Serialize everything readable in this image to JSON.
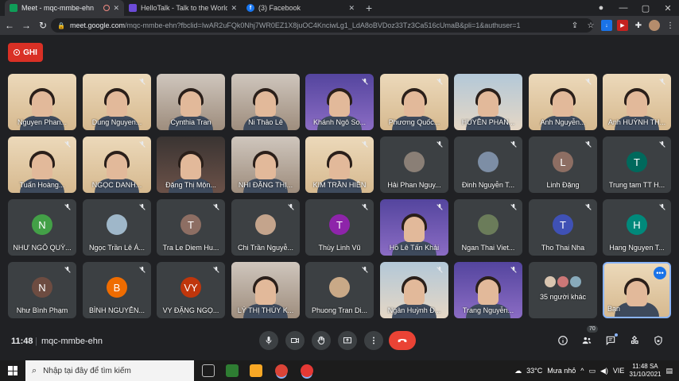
{
  "browser": {
    "tabs": [
      {
        "title": "Meet - mqc-mmbe-ehn",
        "favicon_color": "#0f9d58",
        "active": true
      },
      {
        "title": "HelloTalk - Talk to the World",
        "favicon_color": "#6c4bd8",
        "active": false
      },
      {
        "title": "(3) Facebook",
        "favicon_color": "#1877f2",
        "active": false
      }
    ],
    "new_tab_label": "+",
    "url_domain": "meet.google.com",
    "url_path": "/mqc-mmbe-ehn?fbclid=IwAR2uFQk0Nhj7WR0EZ1X8juOC4KnciwLg1_LdA8oBVDoz33Tz3Ca516cUmaB&pli=1&authuser=1"
  },
  "meet": {
    "record_label": "GHI",
    "participants": [
      {
        "name": "Nguyen Phan...",
        "type": "video",
        "style": "beige",
        "muted": false
      },
      {
        "name": "Dung Nguyen...",
        "type": "video",
        "style": "beige",
        "muted": true
      },
      {
        "name": "Cynthia Tran",
        "type": "video",
        "style": "room",
        "muted": false
      },
      {
        "name": "Ni Thảo Lê",
        "type": "video",
        "style": "room",
        "muted": false
      },
      {
        "name": "Khánh Ngô So...",
        "type": "video",
        "style": "purple",
        "muted": true
      },
      {
        "name": "Phương Quốc...",
        "type": "video",
        "style": "beige",
        "muted": true
      },
      {
        "name": "HUYỀN PHAN...",
        "type": "video",
        "style": "window",
        "muted": false
      },
      {
        "name": "Anh Nguyễn...",
        "type": "video",
        "style": "beige",
        "muted": true
      },
      {
        "name": "Anh HUỲNH TH...",
        "type": "video",
        "style": "beige",
        "muted": true
      },
      {
        "name": "Tuấn Hoàng...",
        "type": "video",
        "style": "beige",
        "muted": true
      },
      {
        "name": "NGỌC DANH...",
        "type": "video",
        "style": "beige",
        "muted": true
      },
      {
        "name": "Đặng Thị Mộn...",
        "type": "video",
        "style": "dark",
        "muted": false
      },
      {
        "name": "NHI ĐẶNG THỊ...",
        "type": "video",
        "style": "room",
        "muted": false
      },
      {
        "name": "KIM TRẦN HIỀN",
        "type": "video",
        "style": "beige",
        "muted": true
      },
      {
        "name": "Hải Phan Nguy...",
        "type": "avatar",
        "letter": "",
        "color": "#8a7f76",
        "muted": true
      },
      {
        "name": "Đinh Nguyễn T...",
        "type": "avatar",
        "letter": "",
        "color": "#7d8ea5",
        "muted": true
      },
      {
        "name": "Linh Đặng",
        "type": "avatar",
        "letter": "L",
        "color": "#8d6e63",
        "muted": true
      },
      {
        "name": "Trung tam TT H...",
        "type": "avatar",
        "letter": "T",
        "color": "#00695c",
        "muted": true
      },
      {
        "name": "NHƯ NGÔ QUỲ...",
        "type": "avatar",
        "letter": "N",
        "color": "#43a047",
        "muted": true
      },
      {
        "name": "Ngọc Trần Lê Á...",
        "type": "avatar",
        "letter": "",
        "color": "#9fb7c9",
        "muted": true
      },
      {
        "name": "Tra Le Diem Hu...",
        "type": "avatar",
        "letter": "T",
        "color": "#8d6e63",
        "muted": true
      },
      {
        "name": "Chi Trần Nguyễ...",
        "type": "avatar",
        "letter": "",
        "color": "#c4a48c",
        "muted": true
      },
      {
        "name": "Thùy Linh Vũ",
        "type": "avatar",
        "letter": "T",
        "color": "#8e24aa",
        "muted": true
      },
      {
        "name": "Hồ Lê Tấn Khải",
        "type": "video",
        "style": "purple",
        "muted": true
      },
      {
        "name": "Ngan Thai Viet...",
        "type": "avatar",
        "letter": "",
        "color": "#6b7c5a",
        "muted": true
      },
      {
        "name": "Tho Thai Nha",
        "type": "avatar",
        "letter": "T",
        "color": "#3f51b5",
        "muted": true
      },
      {
        "name": "Hang Nguyen T...",
        "type": "avatar",
        "letter": "H",
        "color": "#00897b",
        "muted": true
      },
      {
        "name": "Như Bình Phạm",
        "type": "avatar",
        "letter": "N",
        "color": "#6d4c41",
        "muted": true
      },
      {
        "name": "BÌNH NGUYỄN...",
        "type": "avatar",
        "letter": "B",
        "color": "#ef6c00",
        "muted": true
      },
      {
        "name": "VY ĐẶNG NGỌ...",
        "type": "avatar",
        "letter": "VY",
        "color": "#bf360c",
        "muted": true
      },
      {
        "name": "LÝ THỊ THÚY K...",
        "type": "video",
        "style": "room",
        "muted": false
      },
      {
        "name": "Phuong Tran Di...",
        "type": "avatar",
        "letter": "",
        "color": "#c9a987",
        "muted": true
      },
      {
        "name": "Ngân Huỳnh Đ...",
        "type": "video",
        "style": "window",
        "muted": true
      },
      {
        "name": "Trang Nguyễn...",
        "type": "video",
        "style": "purple",
        "muted": true
      },
      {
        "name": "35 người khác",
        "type": "others",
        "muted": false
      },
      {
        "name": "Bạn",
        "type": "self",
        "muted": false
      }
    ]
  },
  "toolbar": {
    "time": "11:48",
    "separator": "|",
    "meeting_code": "mqc-mmbe-ehn",
    "people_count": "70"
  },
  "taskbar": {
    "search_placeholder": "Nhập tại đây để tìm kiếm",
    "weather_temp": "33°C",
    "weather_text": "Mưa nhỏ",
    "language": "VIE",
    "clock_time": "11:48 SA",
    "clock_date": "31/10/2021"
  }
}
